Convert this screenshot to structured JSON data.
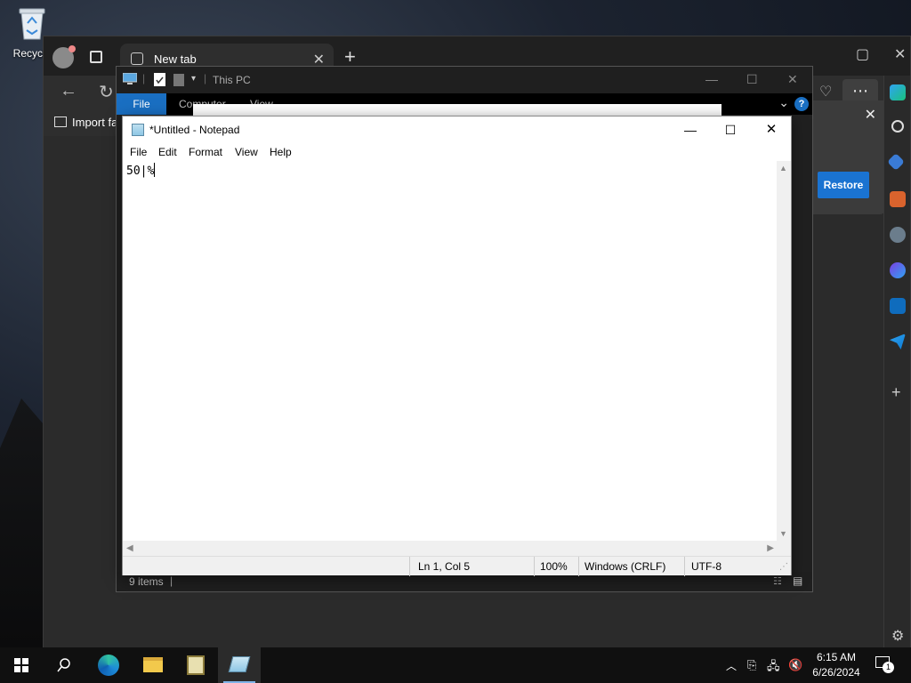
{
  "desktop": {
    "recycle_bin_label": "Recycle"
  },
  "edge": {
    "tab_title": "New tab",
    "favorites_import_label": "Import fa",
    "restore_button": "Restore"
  },
  "explorer": {
    "title": "This PC",
    "ribbon_tabs": [
      "File",
      "Computer",
      "View"
    ],
    "status_items": "9 items"
  },
  "notepad": {
    "title": "*Untitled - Notepad",
    "menu": [
      "File",
      "Edit",
      "Format",
      "View",
      "Help"
    ],
    "content": "50|%",
    "status": {
      "position": "Ln 1, Col 5",
      "zoom": "100%",
      "line_ending": "Windows (CRLF)",
      "encoding": "UTF-8"
    }
  },
  "taskbar": {
    "time": "6:15 AM",
    "date": "6/26/2024",
    "notification_count": "1"
  },
  "colors": {
    "accent_blue": "#1a6fc2",
    "edge_restore_blue": "#1a73d1",
    "taskbar_bg": "#101010"
  }
}
